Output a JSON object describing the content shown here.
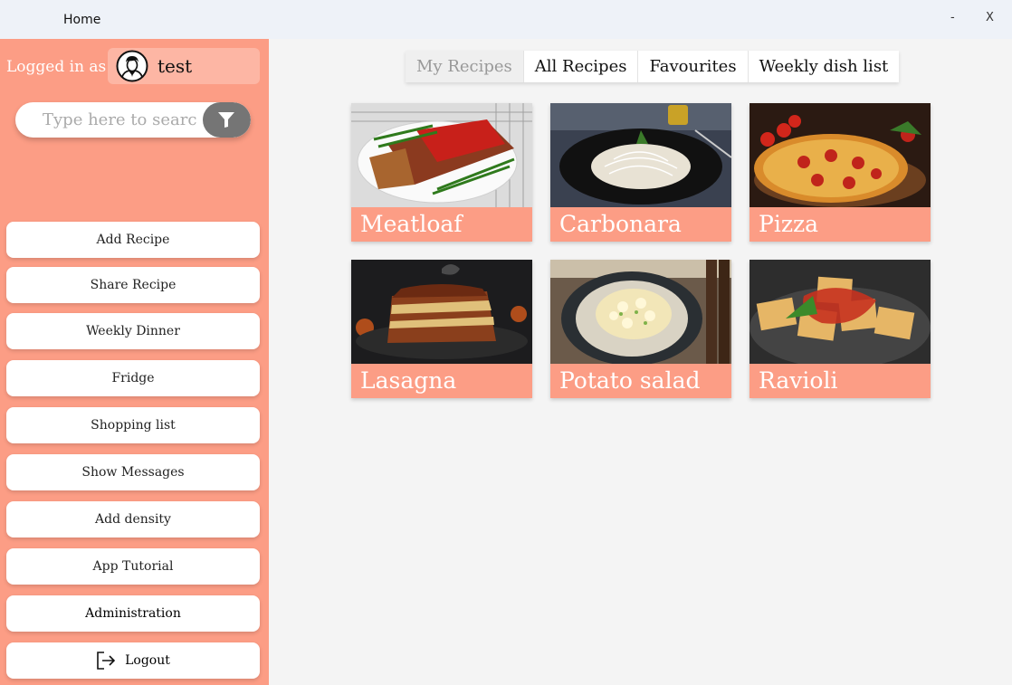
{
  "window": {
    "title": "Home",
    "minimize": "-",
    "close": "X"
  },
  "sidebar": {
    "logged_in_label": "Logged in as:",
    "username": "test",
    "search": {
      "placeholder": "Type here to search",
      "value": ""
    },
    "buttons": [
      {
        "label": "Add Recipe"
      },
      {
        "label": "Share Recipe"
      },
      {
        "label": "Weekly Dinner"
      },
      {
        "label": "Fridge"
      },
      {
        "label": "Shopping list"
      },
      {
        "label": "Show Messages"
      },
      {
        "label": "Add density"
      },
      {
        "label": "App Tutorial"
      },
      {
        "label": "Administration"
      },
      {
        "label": "Logout"
      }
    ]
  },
  "tabs": [
    {
      "label": "My Recipes",
      "active": true
    },
    {
      "label": "All Recipes"
    },
    {
      "label": "Favourites"
    },
    {
      "label": "Weekly dish list"
    }
  ],
  "recipes": [
    {
      "name": "Meatloaf"
    },
    {
      "name": "Carbonara"
    },
    {
      "name": "Pizza"
    },
    {
      "name": "Lasagna"
    },
    {
      "name": "Potato salad"
    },
    {
      "name": "Ravioli"
    }
  ],
  "colors": {
    "accent": "#fc9d85",
    "accent_light": "#fdb6a4",
    "filter_button": "#757575"
  }
}
